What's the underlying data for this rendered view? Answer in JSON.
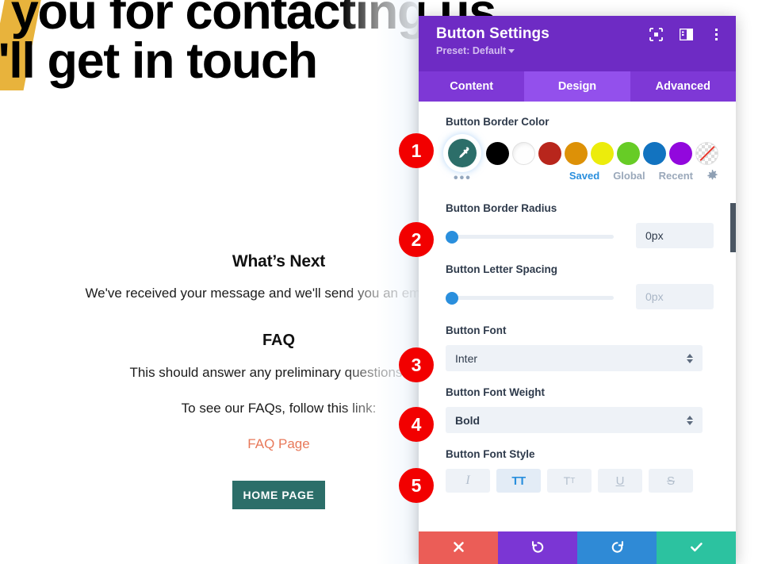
{
  "background": {
    "hero_lines": [
      "k you for contacting us",
      "e'll get in touch"
    ],
    "whats_next_heading": "What’s Next",
    "paragraph_1": "We've received your message and we'll send you an email within",
    "faq_heading": "FAQ",
    "paragraph_2": "This should answer any preliminary questions you",
    "paragraph_3": "To see our FAQs, follow this link:",
    "faq_link_label": "FAQ Page",
    "home_button_label": "HOME PAGE",
    "link_color": "#e8795a",
    "button_color": "#2c6e69"
  },
  "panel": {
    "title": "Button Settings",
    "preset_label": "Preset: Default",
    "header_color": "#6e2bc4",
    "tabs": [
      {
        "label": "Content",
        "active": false
      },
      {
        "label": "Design",
        "active": true
      },
      {
        "label": "Advanced",
        "active": false
      }
    ],
    "header_icons": [
      {
        "name": "focus-icon"
      },
      {
        "name": "layout-panel-icon"
      },
      {
        "name": "more-vertical-icon"
      }
    ],
    "fields": {
      "border_color": {
        "label": "Button Border Color",
        "selected_color": "#2c6e69",
        "swatches": [
          {
            "name": "black",
            "hex": "#000000"
          },
          {
            "name": "white",
            "hex": "#ffffff"
          },
          {
            "name": "dark-red",
            "hex": "#b8261c"
          },
          {
            "name": "orange",
            "hex": "#dd9107"
          },
          {
            "name": "yellow",
            "hex": "#ecec0c"
          },
          {
            "name": "green",
            "hex": "#67cc26"
          },
          {
            "name": "blue",
            "hex": "#1273c0"
          },
          {
            "name": "purple",
            "hex": "#9208dd"
          },
          {
            "name": "transparent",
            "hex": "none"
          }
        ],
        "palette_tabs": [
          {
            "label": "Saved",
            "active": true
          },
          {
            "label": "Global",
            "active": false
          },
          {
            "label": "Recent",
            "active": false
          }
        ],
        "more_dots": "•••"
      },
      "border_radius": {
        "label": "Button Border Radius",
        "value": "0px",
        "slider_percent": 0
      },
      "letter_spacing": {
        "label": "Button Letter Spacing",
        "placeholder": "0px",
        "value": "",
        "slider_percent": 0
      },
      "font": {
        "label": "Button Font",
        "value": "Inter"
      },
      "font_weight": {
        "label": "Button Font Weight",
        "value": "Bold"
      },
      "font_style": {
        "label": "Button Font Style",
        "options": [
          {
            "name": "italic",
            "glyph": "I",
            "active": false
          },
          {
            "name": "uppercase",
            "glyph": "TT",
            "active": true
          },
          {
            "name": "small-caps",
            "glyph": "T",
            "active": false
          },
          {
            "name": "underline",
            "glyph": "U",
            "active": false
          },
          {
            "name": "strikethrough",
            "glyph": "S",
            "active": false
          }
        ]
      }
    },
    "footer_buttons": [
      {
        "name": "cancel",
        "icon": "close-icon",
        "color": "#eb5d57"
      },
      {
        "name": "undo",
        "icon": "undo-icon",
        "color": "#7b36d4"
      },
      {
        "name": "redo",
        "icon": "redo-icon",
        "color": "#2f8ad6"
      },
      {
        "name": "save",
        "icon": "check-icon",
        "color": "#2cc2a0"
      }
    ]
  },
  "badges": [
    {
      "number": "1"
    },
    {
      "number": "2"
    },
    {
      "number": "3"
    },
    {
      "number": "4"
    },
    {
      "number": "5"
    }
  ],
  "colors": {
    "badge": "#f20000",
    "accent_blue": "#2a8fdd"
  }
}
